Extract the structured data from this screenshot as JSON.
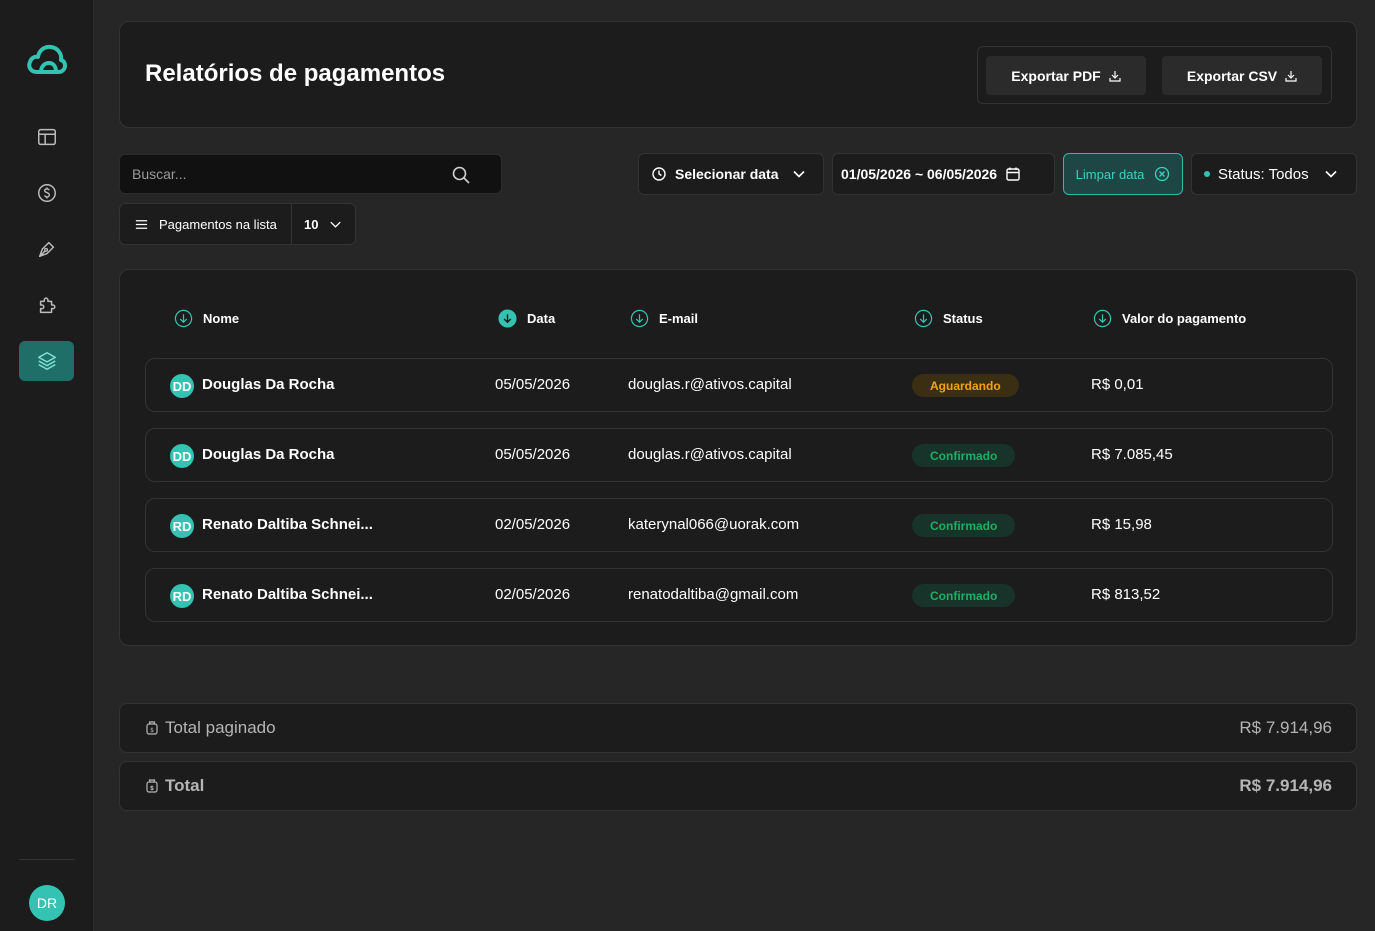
{
  "sidebar": {
    "items": [
      {
        "name": "layout-icon"
      },
      {
        "name": "dollar-icon"
      },
      {
        "name": "pen-icon"
      },
      {
        "name": "puzzle-icon"
      },
      {
        "name": "layers-icon",
        "active": true
      }
    ],
    "user_initials": "DR"
  },
  "header": {
    "title": "Relatórios de pagamentos",
    "export_pdf": "Exportar PDF",
    "export_csv": "Exportar CSV"
  },
  "filters": {
    "search_placeholder": "Buscar...",
    "select_date": "Selecionar data",
    "date_range": "01/05/2026 ~ 06/05/2026",
    "clear_date": "Limpar data",
    "status": "Status: Todos",
    "per_page_label": "Pagamentos na lista",
    "per_page_value": "10"
  },
  "table": {
    "columns": [
      "Nome",
      "Data",
      "E-mail",
      "Status",
      "Valor do pagamento"
    ],
    "rows": [
      {
        "initials": "DD",
        "name": "Douglas Da Rocha",
        "date": "05/05/2026",
        "email": "douglas.r@ativos.capital",
        "status": "Aguardando",
        "value": "R$ 0,01"
      },
      {
        "initials": "DD",
        "name": "Douglas Da Rocha",
        "date": "05/05/2026",
        "email": "douglas.r@ativos.capital",
        "status": "Confirmado",
        "value": "R$ 7.085,45"
      },
      {
        "initials": "RD",
        "name": "Renato Daltiba Schnei...",
        "date": "02/05/2026",
        "email": "katerynal066@uorak.com",
        "status": "Confirmado",
        "value": "R$ 15,98"
      },
      {
        "initials": "RD",
        "name": "Renato Daltiba Schnei...",
        "date": "02/05/2026",
        "email": "renatodaltiba@gmail.com",
        "status": "Confirmado",
        "value": "R$ 813,52"
      }
    ]
  },
  "totals": {
    "paged_label": "Total paginado",
    "paged_value": "R$ 7.914,96",
    "total_label": "Total",
    "total_value": "R$ 7.914,96"
  },
  "colors": {
    "accent": "#34c3b3",
    "waiting": "#f0a317",
    "confirmed": "#1fae63"
  }
}
